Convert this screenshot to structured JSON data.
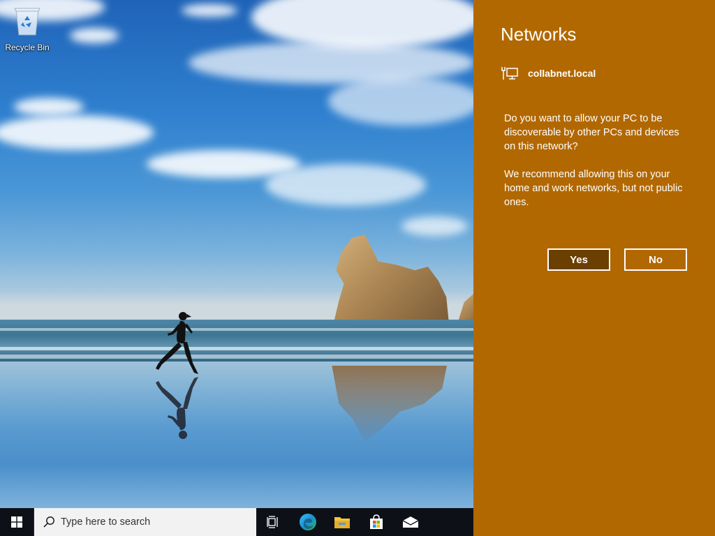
{
  "desktop": {
    "icons": [
      {
        "label": "Recycle Bin",
        "icon": "recycle-bin-icon"
      }
    ]
  },
  "flyout": {
    "title": "Networks",
    "network_name": "collabnet.local",
    "network_icon": "wired-network-icon",
    "question": "Do you want to allow your PC to be discoverable by other PCs and devices on this network?",
    "recommendation": "We recommend allowing this on your home and work networks, but not public ones.",
    "yes_label": "Yes",
    "no_label": "No",
    "accent_color": "#b26800"
  },
  "taskbar": {
    "search_placeholder": "Type here to search",
    "pinned": [
      "task-view-icon",
      "edge-icon",
      "file-explorer-icon",
      "store-icon",
      "mail-icon"
    ]
  }
}
